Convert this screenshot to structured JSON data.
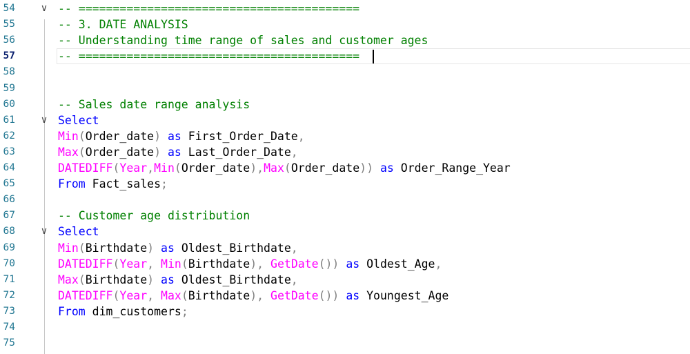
{
  "editor": {
    "active_line": 57,
    "lines": [
      {
        "num": "54",
        "fold": "expanded",
        "tokens": [
          {
            "t": "c",
            "v": "-- ========================================="
          }
        ]
      },
      {
        "num": "55",
        "fold": "",
        "tokens": [
          {
            "t": "c",
            "v": "-- 3. DATE ANALYSIS"
          }
        ]
      },
      {
        "num": "56",
        "fold": "",
        "tokens": [
          {
            "t": "c",
            "v": "-- Understanding time range of sales and customer ages"
          }
        ]
      },
      {
        "num": "57",
        "fold": "",
        "tokens": [
          {
            "t": "c",
            "v": "-- ========================================="
          }
        ]
      },
      {
        "num": "58",
        "fold": "",
        "tokens": []
      },
      {
        "num": "59",
        "fold": "",
        "tokens": []
      },
      {
        "num": "60",
        "fold": "",
        "tokens": [
          {
            "t": "c",
            "v": "-- Sales date range analysis"
          }
        ]
      },
      {
        "num": "61",
        "fold": "expanded",
        "tokens": [
          {
            "t": "k",
            "v": "Select"
          }
        ]
      },
      {
        "num": "62",
        "fold": "",
        "tokens": [
          {
            "t": "f",
            "v": "Min"
          },
          {
            "t": "p",
            "v": "("
          },
          {
            "t": "i",
            "v": "Order_date"
          },
          {
            "t": "p",
            "v": ")"
          },
          {
            "t": "i",
            "v": " "
          },
          {
            "t": "k",
            "v": "as"
          },
          {
            "t": "i",
            "v": " First_Order_Date"
          },
          {
            "t": "p",
            "v": ","
          }
        ]
      },
      {
        "num": "63",
        "fold": "",
        "tokens": [
          {
            "t": "f",
            "v": "Max"
          },
          {
            "t": "p",
            "v": "("
          },
          {
            "t": "i",
            "v": "Order_date"
          },
          {
            "t": "p",
            "v": ")"
          },
          {
            "t": "i",
            "v": " "
          },
          {
            "t": "k",
            "v": "as"
          },
          {
            "t": "i",
            "v": " Last_Order_Date"
          },
          {
            "t": "p",
            "v": ","
          }
        ]
      },
      {
        "num": "64",
        "fold": "",
        "tokens": [
          {
            "t": "f",
            "v": "DATEDIFF"
          },
          {
            "t": "p",
            "v": "("
          },
          {
            "t": "f",
            "v": "Year"
          },
          {
            "t": "p",
            "v": ","
          },
          {
            "t": "f",
            "v": "Min"
          },
          {
            "t": "p",
            "v": "("
          },
          {
            "t": "i",
            "v": "Order_date"
          },
          {
            "t": "p",
            "v": "),"
          },
          {
            "t": "f",
            "v": "Max"
          },
          {
            "t": "p",
            "v": "("
          },
          {
            "t": "i",
            "v": "Order_date"
          },
          {
            "t": "p",
            "v": "))"
          },
          {
            "t": "i",
            "v": " "
          },
          {
            "t": "k",
            "v": "as"
          },
          {
            "t": "i",
            "v": " Order_Range_Year"
          }
        ]
      },
      {
        "num": "65",
        "fold": "",
        "tokens": [
          {
            "t": "k",
            "v": "From"
          },
          {
            "t": "i",
            "v": " Fact_sales"
          },
          {
            "t": "p",
            "v": ";"
          }
        ]
      },
      {
        "num": "66",
        "fold": "",
        "tokens": []
      },
      {
        "num": "67",
        "fold": "",
        "tokens": [
          {
            "t": "c",
            "v": "-- Customer age distribution"
          }
        ]
      },
      {
        "num": "68",
        "fold": "expanded",
        "tokens": [
          {
            "t": "k",
            "v": "Select"
          }
        ]
      },
      {
        "num": "69",
        "fold": "",
        "tokens": [
          {
            "t": "f",
            "v": "Min"
          },
          {
            "t": "p",
            "v": "("
          },
          {
            "t": "i",
            "v": "Birthdate"
          },
          {
            "t": "p",
            "v": ")"
          },
          {
            "t": "i",
            "v": " "
          },
          {
            "t": "k",
            "v": "as"
          },
          {
            "t": "i",
            "v": " Oldest_Birthdate"
          },
          {
            "t": "p",
            "v": ","
          }
        ]
      },
      {
        "num": "70",
        "fold": "",
        "tokens": [
          {
            "t": "f",
            "v": "DATEDIFF"
          },
          {
            "t": "p",
            "v": "("
          },
          {
            "t": "f",
            "v": "Year"
          },
          {
            "t": "p",
            "v": ", "
          },
          {
            "t": "f",
            "v": "Min"
          },
          {
            "t": "p",
            "v": "("
          },
          {
            "t": "i",
            "v": "Birthdate"
          },
          {
            "t": "p",
            "v": "), "
          },
          {
            "t": "f",
            "v": "GetDate"
          },
          {
            "t": "p",
            "v": "())"
          },
          {
            "t": "i",
            "v": " "
          },
          {
            "t": "k",
            "v": "as"
          },
          {
            "t": "i",
            "v": " Oldest_Age"
          },
          {
            "t": "p",
            "v": ","
          }
        ]
      },
      {
        "num": "71",
        "fold": "",
        "tokens": [
          {
            "t": "f",
            "v": "Max"
          },
          {
            "t": "p",
            "v": "("
          },
          {
            "t": "i",
            "v": "Birthdate"
          },
          {
            "t": "p",
            "v": ")"
          },
          {
            "t": "i",
            "v": " "
          },
          {
            "t": "k",
            "v": "as"
          },
          {
            "t": "i",
            "v": " Oldest_Birthdate"
          },
          {
            "t": "p",
            "v": ","
          }
        ]
      },
      {
        "num": "72",
        "fold": "",
        "tokens": [
          {
            "t": "f",
            "v": "DATEDIFF"
          },
          {
            "t": "p",
            "v": "("
          },
          {
            "t": "f",
            "v": "Year"
          },
          {
            "t": "p",
            "v": ", "
          },
          {
            "t": "f",
            "v": "Max"
          },
          {
            "t": "p",
            "v": "("
          },
          {
            "t": "i",
            "v": "Birthdate"
          },
          {
            "t": "p",
            "v": "), "
          },
          {
            "t": "f",
            "v": "GetDate"
          },
          {
            "t": "p",
            "v": "())"
          },
          {
            "t": "i",
            "v": " "
          },
          {
            "t": "k",
            "v": "as"
          },
          {
            "t": "i",
            "v": " Youngest_Age"
          }
        ]
      },
      {
        "num": "73",
        "fold": "",
        "tokens": [
          {
            "t": "k",
            "v": "From"
          },
          {
            "t": "i",
            "v": " dim_customers"
          },
          {
            "t": "p",
            "v": ";"
          }
        ]
      },
      {
        "num": "74",
        "fold": "",
        "tokens": []
      },
      {
        "num": "75",
        "fold": "",
        "tokens": []
      }
    ]
  },
  "colors": {
    "comment": "#008000",
    "keyword": "#0000ff",
    "function": "#ff00ff",
    "punctuation": "#808080",
    "identifier": "#000000",
    "line_number": "#237893"
  },
  "icons": {
    "fold_expanded": "chevron-down-icon"
  }
}
